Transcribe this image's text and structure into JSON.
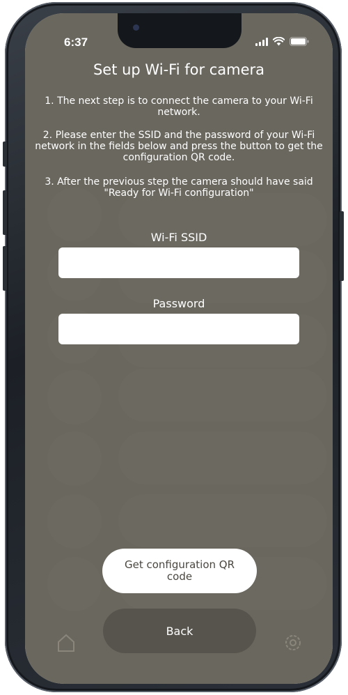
{
  "status_bar": {
    "time": "6:37",
    "icons": [
      "cellular-signal-icon",
      "wifi-icon",
      "battery-icon"
    ]
  },
  "dialog": {
    "title": "Set up Wi-Fi for camera",
    "steps": [
      "1. The next step is to connect the camera to your Wi-Fi network.",
      "2. Please enter the SSID and the password of your Wi-Fi network in the fields below and press the button to get the configuration QR code.",
      "3. After the previous step the camera should have said \"Ready for Wi-Fi configuration\""
    ],
    "ssid_label": "Wi-Fi SSID",
    "ssid_value": "",
    "password_label": "Password",
    "password_value": "",
    "qr_button_label": "Get configuration QR code",
    "back_button_label": "Back"
  },
  "colors": {
    "overlay": "#605d56",
    "background_app": "#a8a397",
    "button_light": "#ffffff",
    "button_dark": "#57544d"
  }
}
